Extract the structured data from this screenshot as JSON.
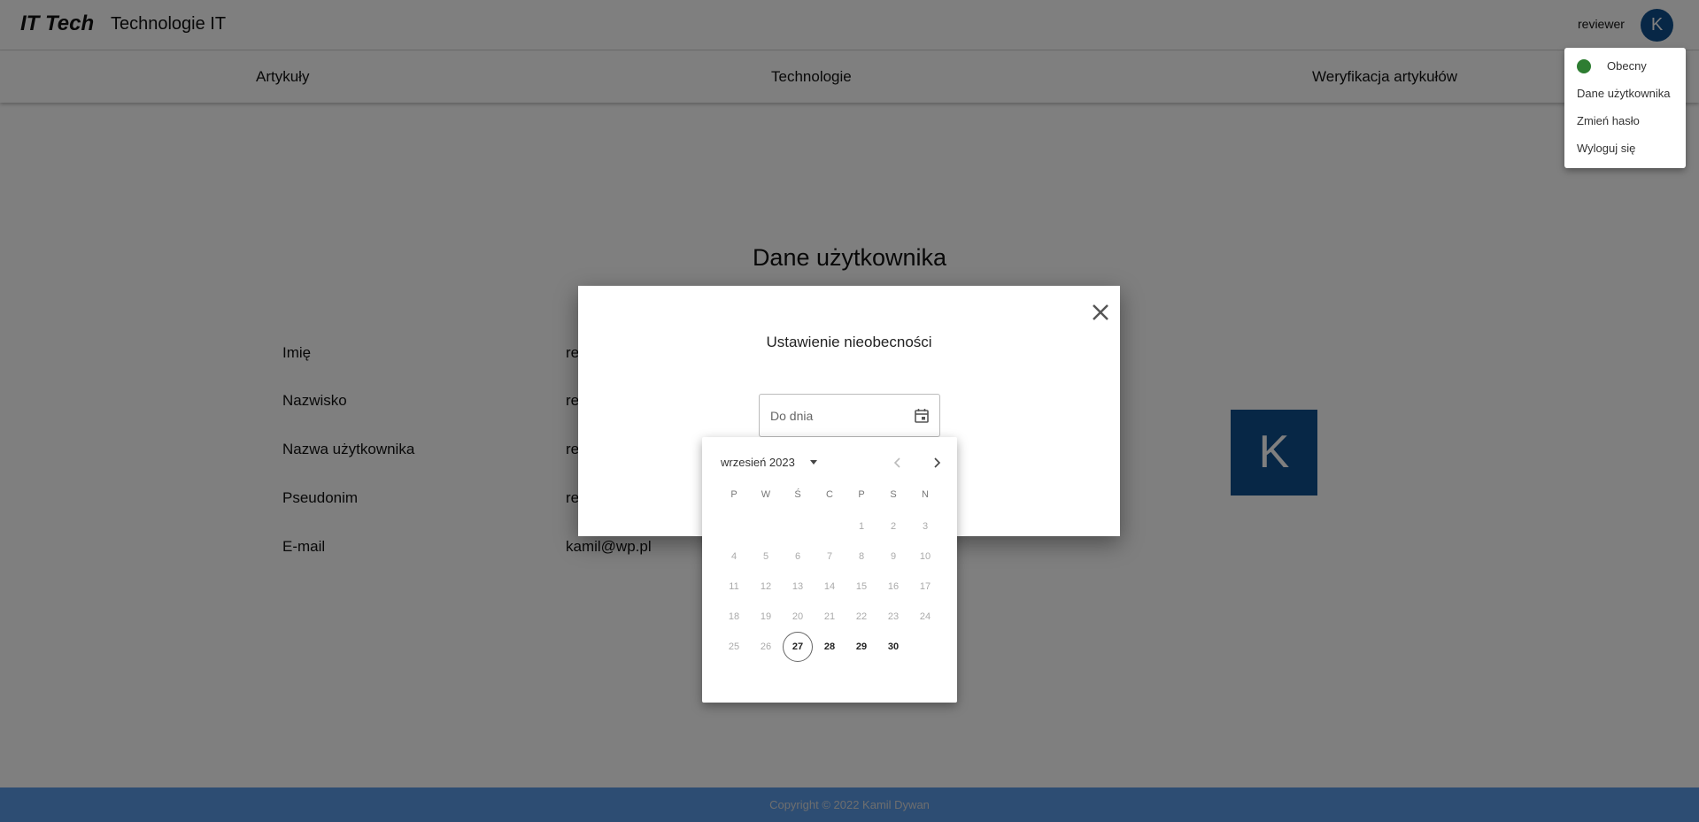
{
  "header": {
    "brand": "IT Tech",
    "title": "Technologie IT",
    "username": "reviewer",
    "avatar_letter": "K"
  },
  "nav": {
    "items": [
      "Artykuły",
      "Technologie",
      "Weryfikacja artykułów"
    ]
  },
  "main": {
    "title": "Dane użytkownika",
    "fields": [
      {
        "label": "Imię",
        "value": "re"
      },
      {
        "label": "Nazwisko",
        "value": "re"
      },
      {
        "label": "Nazwa użytkownika",
        "value": "re"
      },
      {
        "label": "Pseudonim",
        "value": "re"
      },
      {
        "label": "E-mail",
        "value": "kamil@wp.pl"
      }
    ],
    "avatar_letter": "K"
  },
  "footer": {
    "text": "Copyright © 2022 Kamil Dywan"
  },
  "status_menu": {
    "status": "Obecny",
    "status_color": "#2e7d32",
    "items": [
      "Dane użytkownika",
      "Zmień hasło",
      "Wyloguj się"
    ]
  },
  "modal": {
    "title": "Ustawienie nieobecności",
    "date_placeholder": "Do dnia"
  },
  "date_picker": {
    "month_label": "wrzesień 2023",
    "weekdays": [
      "P",
      "W",
      "Ś",
      "C",
      "P",
      "S",
      "N"
    ],
    "weeks": [
      [
        "",
        "",
        "",
        "",
        "1",
        "2",
        "3"
      ],
      [
        "4",
        "5",
        "6",
        "7",
        "8",
        "9",
        "10"
      ],
      [
        "11",
        "12",
        "13",
        "14",
        "15",
        "16",
        "17"
      ],
      [
        "18",
        "19",
        "20",
        "21",
        "22",
        "23",
        "24"
      ],
      [
        "25",
        "26",
        "27",
        "28",
        "29",
        "30",
        ""
      ]
    ],
    "today": "27",
    "enabled_days": [
      "27",
      "28",
      "29",
      "30"
    ]
  },
  "colors": {
    "accent": "#0f4f8c",
    "footer": "#5a9ae6"
  }
}
